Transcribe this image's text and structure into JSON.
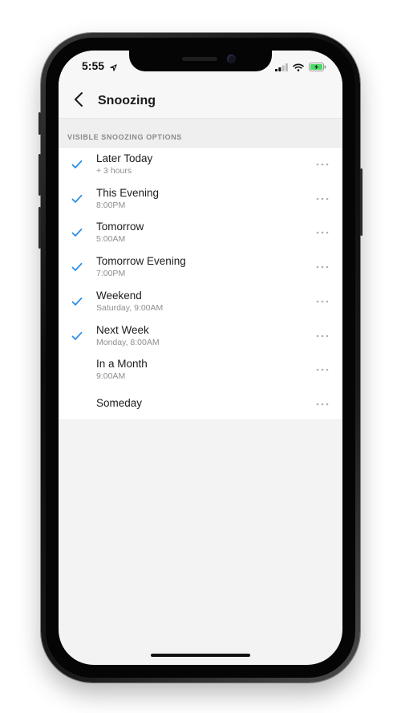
{
  "status": {
    "time": "5:55",
    "location_icon": "location-arrow-icon",
    "signal_icon": "cellular-signal-icon",
    "wifi_icon": "wifi-icon",
    "battery_icon": "battery-charging-icon",
    "battery_color": "#4cd964"
  },
  "nav": {
    "back_icon": "chevron-left-icon",
    "title": "Snoozing"
  },
  "section": {
    "header": "VISIBLE SNOOZING OPTIONS"
  },
  "accent_color": "#2b8fe6",
  "options": [
    {
      "title": "Later Today",
      "subtitle": "+ 3 hours",
      "checked": true
    },
    {
      "title": "This Evening",
      "subtitle": "8:00PM",
      "checked": true
    },
    {
      "title": "Tomorrow",
      "subtitle": "5:00AM",
      "checked": true
    },
    {
      "title": "Tomorrow Evening",
      "subtitle": "7:00PM",
      "checked": true
    },
    {
      "title": "Weekend",
      "subtitle": "Saturday, 9:00AM",
      "checked": true
    },
    {
      "title": "Next Week",
      "subtitle": "Monday, 8:00AM",
      "checked": true
    },
    {
      "title": "In a Month",
      "subtitle": "9:00AM",
      "checked": false
    },
    {
      "title": "Someday",
      "subtitle": "",
      "checked": false
    }
  ]
}
